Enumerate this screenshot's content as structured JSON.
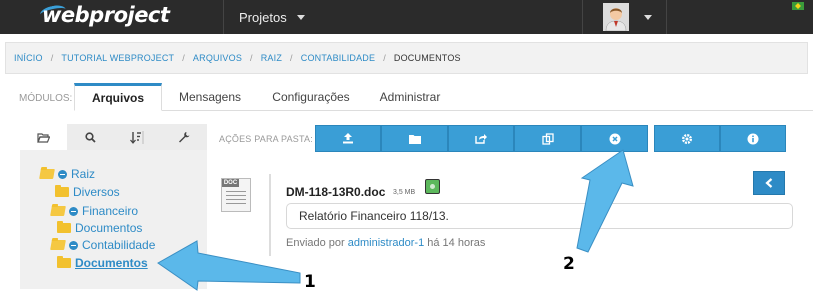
{
  "app": {
    "logo_text": "webproject",
    "projects_label": "Projetos"
  },
  "breadcrumb": {
    "items": [
      "INÍCIO",
      "TUTORIAL WEBPROJECT",
      "ARQUIVOS",
      "RAIZ",
      "CONTABILIDADE",
      "DOCUMENTOS"
    ]
  },
  "modules": {
    "label": "MÓDULOS:",
    "tabs": [
      "Arquivos",
      "Mensagens",
      "Configurações",
      "Administrar"
    ],
    "active_tab": "Arquivos"
  },
  "left_panel": {
    "tab_icons": [
      "folder-open-icon",
      "search-icon",
      "sort-icon",
      "wrench-icon"
    ],
    "tree": [
      {
        "label": "Raiz",
        "level": 0,
        "expanded": true
      },
      {
        "label": "Diversos",
        "level": 1,
        "expanded": false
      },
      {
        "label": "Financeiro",
        "level": 1,
        "expanded": true
      },
      {
        "label": "Documentos",
        "level": 2,
        "expanded": false
      },
      {
        "label": "Contabilidade",
        "level": 1,
        "expanded": true
      },
      {
        "label": "Documentos",
        "level": 2,
        "expanded": false,
        "selected": true
      }
    ]
  },
  "actions": {
    "label": "AÇÕES PARA PASTA:",
    "buttons": [
      "upload-icon",
      "folder-icon",
      "share-icon",
      "copy-icon",
      "close-circle-icon",
      "gear-icon",
      "info-icon"
    ]
  },
  "file": {
    "icon_tag": "DOC",
    "name": "DM-118-13R0.doc",
    "size": "3,5 MB",
    "description": "Relatório Financeiro 118/13.",
    "sent_prefix": "Enviado por",
    "sent_user": "administrador-1",
    "sent_suffix": "há 14 horas"
  },
  "annotations": {
    "label_1": "1",
    "label_2": "2"
  },
  "colors": {
    "accent": "#2e8bc6",
    "button": "#3a9ed6",
    "topbar": "#2b2b2b",
    "arrow": "#5bb8ea"
  }
}
